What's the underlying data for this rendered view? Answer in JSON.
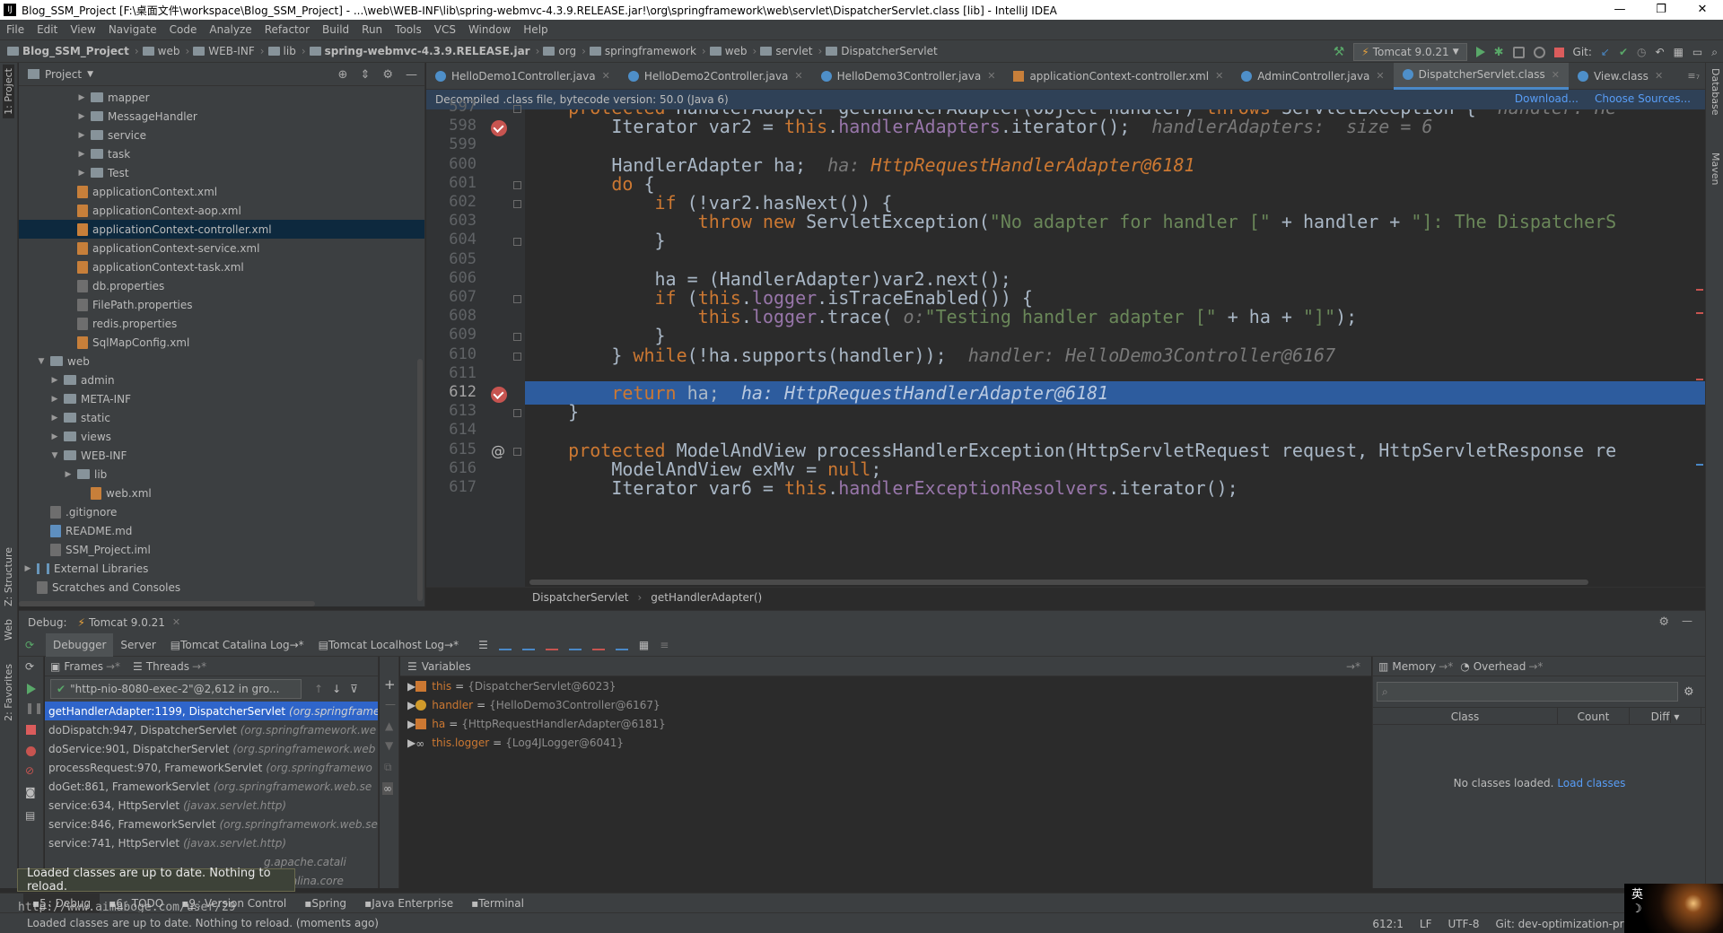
{
  "titlebar": {
    "title": "Blog_SSM_Project [F:\\桌面文件\\workspace\\Blog_SSM_Project] - ...\\web\\WEB-INF\\lib\\spring-webmvc-4.3.9.RELEASE.jar!\\org\\springframework\\web\\servlet\\DispatcherServlet.class [lib] - IntelliJ IDEA",
    "minimize": "—",
    "restore": "❐",
    "close": "✕"
  },
  "menu": [
    "File",
    "Edit",
    "View",
    "Navigate",
    "Code",
    "Analyze",
    "Refactor",
    "Build",
    "Run",
    "Tools",
    "VCS",
    "Window",
    "Help"
  ],
  "navbar": {
    "crumbs": [
      "Blog_SSM_Project",
      "web",
      "WEB-INF",
      "lib",
      "spring-webmvc-4.3.9.RELEASE.jar",
      "org",
      "springframework",
      "web",
      "servlet",
      "DispatcherServlet"
    ],
    "run_config": "Tomcat 9.0.21",
    "git_label": "Git:"
  },
  "stripes": {
    "left_top": "1: Project",
    "left_structure": "Z: Structure",
    "left_web": "Web",
    "left_favorites": "2: Favorites",
    "right_db": "Database",
    "right_maven": "Maven"
  },
  "project": {
    "title": "Project",
    "items": [
      {
        "label": "mapper",
        "indent": 4,
        "kind": "folder",
        "arrow": "▶"
      },
      {
        "label": "MessageHandler",
        "indent": 4,
        "kind": "folder",
        "arrow": "▶"
      },
      {
        "label": "service",
        "indent": 4,
        "kind": "folder",
        "arrow": "▶"
      },
      {
        "label": "task",
        "indent": 4,
        "kind": "folder",
        "arrow": "▶"
      },
      {
        "label": "Test",
        "indent": 4,
        "kind": "folder",
        "arrow": "▶"
      },
      {
        "label": "applicationContext.xml",
        "indent": 3,
        "kind": "xml",
        "arrow": ""
      },
      {
        "label": "applicationContext-aop.xml",
        "indent": 3,
        "kind": "xml",
        "arrow": ""
      },
      {
        "label": "applicationContext-controller.xml",
        "indent": 3,
        "kind": "xml",
        "arrow": "",
        "selected": true
      },
      {
        "label": "applicationContext-service.xml",
        "indent": 3,
        "kind": "xml",
        "arrow": ""
      },
      {
        "label": "applicationContext-task.xml",
        "indent": 3,
        "kind": "xml",
        "arrow": ""
      },
      {
        "label": "db.properties",
        "indent": 3,
        "kind": "prop",
        "arrow": ""
      },
      {
        "label": "FilePath.properties",
        "indent": 3,
        "kind": "prop",
        "arrow": ""
      },
      {
        "label": "redis.properties",
        "indent": 3,
        "kind": "prop",
        "arrow": ""
      },
      {
        "label": "SqlMapConfig.xml",
        "indent": 3,
        "kind": "xml",
        "arrow": ""
      },
      {
        "label": "web",
        "indent": 1,
        "kind": "folder",
        "arrow": "▼"
      },
      {
        "label": "admin",
        "indent": 2,
        "kind": "folder",
        "arrow": "▶"
      },
      {
        "label": "META-INF",
        "indent": 2,
        "kind": "folder",
        "arrow": "▶"
      },
      {
        "label": "static",
        "indent": 2,
        "kind": "folder",
        "arrow": "▶"
      },
      {
        "label": "views",
        "indent": 2,
        "kind": "folder",
        "arrow": "▶"
      },
      {
        "label": "WEB-INF",
        "indent": 2,
        "kind": "folder",
        "arrow": "▼"
      },
      {
        "label": "lib",
        "indent": 3,
        "kind": "folder",
        "arrow": "▶"
      },
      {
        "label": "web.xml",
        "indent": 4,
        "kind": "xml",
        "arrow": ""
      },
      {
        "label": ".gitignore",
        "indent": 1,
        "kind": "prop",
        "arrow": ""
      },
      {
        "label": "README.md",
        "indent": 1,
        "kind": "md",
        "arrow": ""
      },
      {
        "label": "SSM_Project.iml",
        "indent": 1,
        "kind": "prop",
        "arrow": ""
      },
      {
        "label": "External Libraries",
        "indent": 0,
        "kind": "lib",
        "arrow": "▶"
      },
      {
        "label": "Scratches and Consoles",
        "indent": 0,
        "kind": "prop",
        "arrow": ""
      }
    ]
  },
  "editor": {
    "tabs": [
      {
        "label": "HelloDemo1Controller.java",
        "kind": "class"
      },
      {
        "label": "HelloDemo2Controller.java",
        "kind": "class"
      },
      {
        "label": "HelloDemo3Controller.java",
        "kind": "class"
      },
      {
        "label": "applicationContext-controller.xml",
        "kind": "xml"
      },
      {
        "label": "AdminController.java",
        "kind": "class"
      },
      {
        "label": "DispatcherServlet.class",
        "kind": "class",
        "active": true
      },
      {
        "label": "View.class",
        "kind": "class"
      }
    ],
    "tab_overflow": "≡₇",
    "banner": "Decompiled .class file, bytecode version: 50.0 (Java 6)",
    "banner_download": "Download...",
    "banner_sources": "Choose Sources...",
    "lines": [
      {
        "n": "597",
        "html": "    <span class='kw'>protected</span> HandlerAdapter getHandlerAdapter(Object handler) <span class='kw'>throws</span> ServletException {  <span class='hint'>handler: He</span>"
      },
      {
        "n": "598",
        "html": "        Iterator var2 = <span class='kw'>this</span>.<span class='fld'>handlerAdapters</span>.iterator();  <span class='hint'>handlerAdapters:  size = 6</span>",
        "bp": true
      },
      {
        "n": "599",
        "html": ""
      },
      {
        "n": "600",
        "html": "        HandlerAdapter ha;  <span class='hint'>ha: </span><span class='hint-o'>HttpRequestHandlerAdapter@6181</span>"
      },
      {
        "n": "601",
        "html": "        <span class='kw'>do</span> {"
      },
      {
        "n": "602",
        "html": "            <span class='kw'>if</span> (!var2.hasNext()) {"
      },
      {
        "n": "603",
        "html": "                <span class='kw'>throw new</span> ServletException(<span class='str'>\"No adapter for handler [\"</span> + handler + <span class='str'>\"]: The DispatcherS</span>"
      },
      {
        "n": "604",
        "html": "            }"
      },
      {
        "n": "605",
        "html": ""
      },
      {
        "n": "606",
        "html": "            ha = (HandlerAdapter)var2.next();"
      },
      {
        "n": "607",
        "html": "            <span class='kw'>if</span> (<span class='kw'>this</span>.<span class='fld'>logger</span>.isTraceEnabled()) {"
      },
      {
        "n": "608",
        "html": "                <span class='kw'>this</span>.<span class='fld'>logger</span>.trace( <span class='hint'>o:</span><span class='str'>\"Testing handler adapter [\"</span> + ha + <span class='str'>\"]\"</span>);"
      },
      {
        "n": "609",
        "html": "            }"
      },
      {
        "n": "610",
        "html": "        } <span class='kw'>while</span>(!ha.supports(handler));  <span class='hint'>handler: HelloDemo3Controller@6167</span>"
      },
      {
        "n": "611",
        "html": ""
      },
      {
        "n": "612",
        "html": "        <span class='kw'>return</span> ha;  <span class='hint' style='color:#b9c9e0'>ha: HttpRequestHandlerAdapter@6181</span>",
        "bp": true,
        "exec": true
      },
      {
        "n": "613",
        "html": "    }"
      },
      {
        "n": "614",
        "html": ""
      },
      {
        "n": "615",
        "html": "    <span class='kw'>protected</span> ModelAndView processHandlerException(HttpServletRequest request, HttpServletResponse re",
        "at": true
      },
      {
        "n": "616",
        "html": "        ModelAndView exMv = <span class='kw'>null</span>;"
      },
      {
        "n": "617",
        "html": "        Iterator var6 = <span class='kw'>this</span>.<span class='fld'>handlerExceptionResolvers</span>.iterator();"
      }
    ],
    "crumb_class": "DispatcherServlet",
    "crumb_method": "getHandlerAdapter()"
  },
  "debug": {
    "label": "Debug:",
    "session": "Tomcat 9.0.21",
    "tabs": [
      "Debugger",
      "Server",
      "Tomcat Catalina Log",
      "Tomcat Localhost Log"
    ],
    "frames_label": "Frames",
    "threads_label": "Threads",
    "thread": "\"http-nio-8080-exec-2\"@2,612 in gro...",
    "frames": [
      {
        "m": "getHandlerAdapter:1199, DispatcherServlet",
        "p": "(org.springframe",
        "sel": true
      },
      {
        "m": "doDispatch:947, DispatcherServlet",
        "p": "(org.springframework.we"
      },
      {
        "m": "doService:901, DispatcherServlet",
        "p": "(org.springframework.web"
      },
      {
        "m": "processRequest:970, FrameworkServlet",
        "p": "(org.springframewo"
      },
      {
        "m": "doGet:861, FrameworkServlet",
        "p": "(org.springframework.web.se"
      },
      {
        "m": "service:634, HttpServlet",
        "p": "(javax.servlet.http)"
      },
      {
        "m": "service:846, FrameworkServlet",
        "p": "(org.springframework.web.se"
      },
      {
        "m": "service:741, HttpServlet",
        "p": "(javax.servlet.http)"
      },
      {
        "m": "",
        "p": "g.apache.catali"
      },
      {
        "m": "",
        "p": "e.catalina.core"
      }
    ],
    "variables_label": "Variables",
    "variables": [
      {
        "name": "this",
        "value": "{DispatcherServlet@6023}"
      },
      {
        "name": "handler",
        "value": "{HelloDemo3Controller@6167}"
      },
      {
        "name": "ha",
        "value": "{HttpRequestHandlerAdapter@6181}"
      },
      {
        "name": "this.logger",
        "value": "{Log4JLogger@6041}"
      }
    ],
    "memory_label": "Memory",
    "overhead_label": "Overhead",
    "mem_cols": [
      "Class",
      "Count",
      "Diff"
    ],
    "mem_empty": "No classes loaded.",
    "mem_load": "Load classes"
  },
  "toast": "Loaded classes are up to date. Nothing to reload.",
  "toolwindows": [
    {
      "n": "5",
      "label": ": Debug",
      "active": true
    },
    {
      "n": "6",
      "label": ": TODO"
    },
    {
      "n": "9",
      "label": ": Version Control"
    },
    {
      "n": "",
      "label": "Spring"
    },
    {
      "n": "",
      "label": "Java Enterprise"
    },
    {
      "n": "",
      "label": "Terminal"
    }
  ],
  "watermark": "http://www.aimaboge.com/user/29",
  "status": {
    "message": "Loaded classes are up to date. Nothing to reload. (moments ago)",
    "position": "612:1",
    "line_sep": "LF",
    "encoding": "UTF-8",
    "git": "Git: dev-optimization-priv"
  },
  "tray": {
    "ime1": "英",
    "ime2": "☽"
  }
}
